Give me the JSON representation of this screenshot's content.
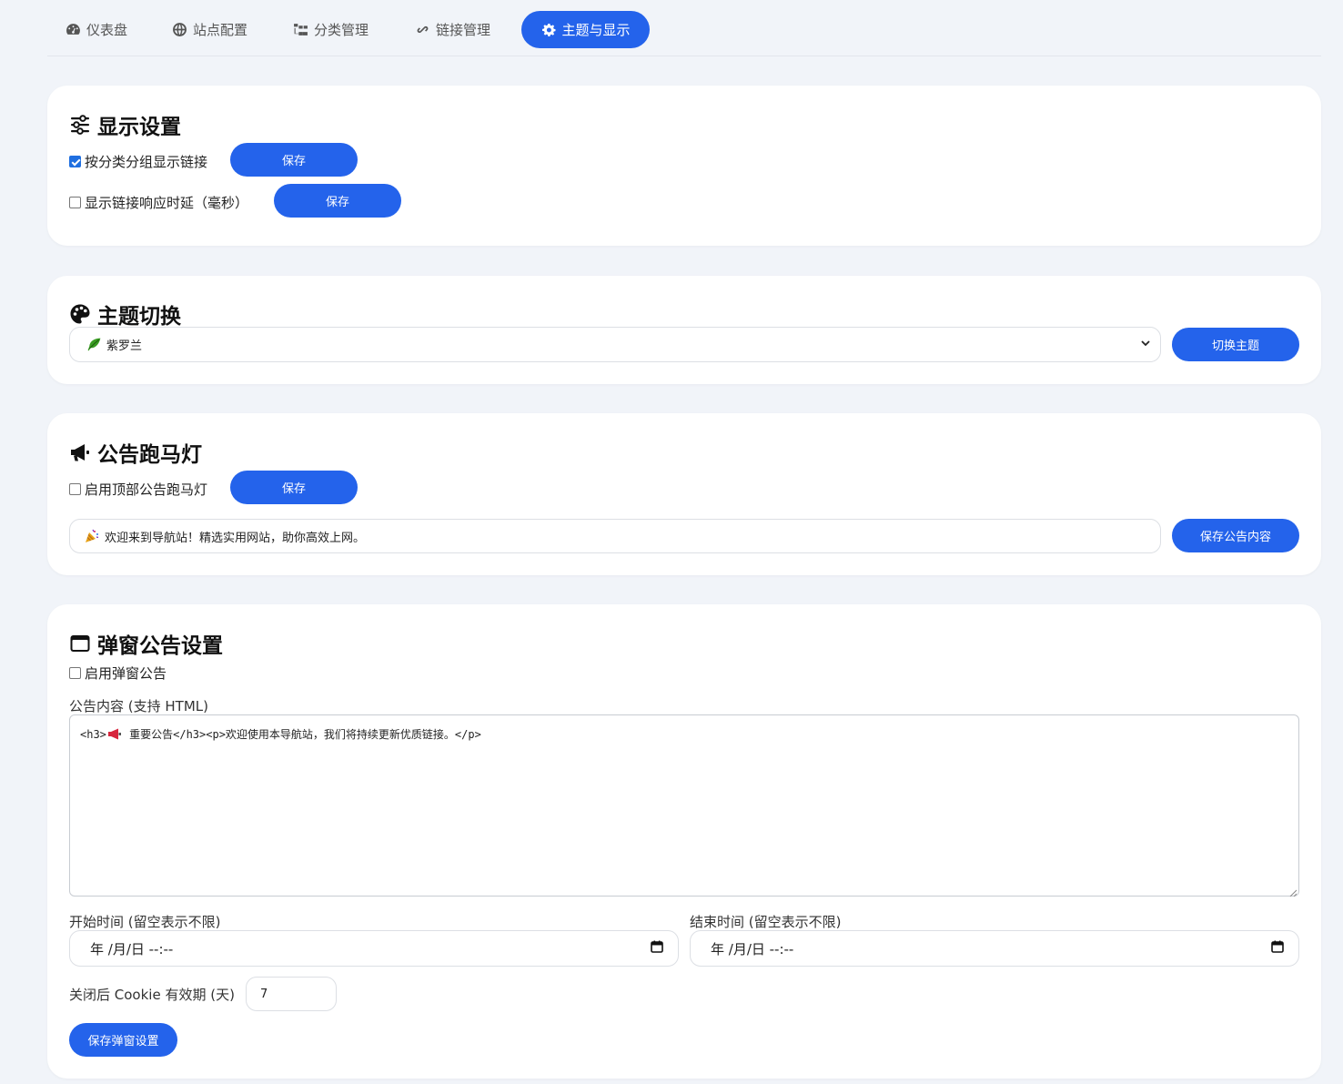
{
  "tabs": [
    {
      "label": "仪表盘",
      "icon": "dashboard-icon",
      "active": false
    },
    {
      "label": "站点配置",
      "icon": "globe-icon",
      "active": false
    },
    {
      "label": "分类管理",
      "icon": "sitemap-icon",
      "active": false
    },
    {
      "label": "链接管理",
      "icon": "link-icon",
      "active": false
    },
    {
      "label": "主题与显示",
      "icon": "gear-icon",
      "active": true
    }
  ],
  "display_settings": {
    "title": "显示设置",
    "icon": "sliders-icon",
    "group_by_category": {
      "label": "按分类分组显示链接",
      "checked": true,
      "save_label": "保存"
    },
    "show_latency": {
      "label": "显示链接响应时延（毫秒）",
      "checked": false,
      "save_label": "保存"
    }
  },
  "theme_switch": {
    "title": "主题切换",
    "icon": "palette-icon",
    "selected_option": "紫罗兰",
    "selected_option_icon": "leaf-icon",
    "button_label": "切换主题"
  },
  "marquee": {
    "title": "公告跑马灯",
    "icon": "megaphone-icon",
    "enable_label": "启用顶部公告跑马灯",
    "enabled": false,
    "save_label": "保存",
    "content_value": "欢迎来到导航站！精选实用网站，助你高效上网。",
    "content_icon": "party-popper-icon",
    "save_content_label": "保存公告内容"
  },
  "popup": {
    "title": "弹窗公告设置",
    "icon": "window-icon",
    "enable_label": "启用弹窗公告",
    "enabled": false,
    "content_label": "公告内容 (支持 HTML)",
    "content_before_icon": "<h3>",
    "content_icon": "megaphone-icon",
    "content_after_icon": " 重要公告</h3><p>欢迎使用本导航站，我们将持续更新优质链接。</p>",
    "start_label": "开始时间 (留空表示不限)",
    "end_label": "结束时间 (留空表示不限)",
    "date_placeholder": "年 /月/日 --:--",
    "cookie_label": "关闭后 Cookie 有效期 (天)",
    "cookie_days": "7",
    "save_label": "保存弹窗设置"
  },
  "colors": {
    "accent": "#2463eb",
    "background": "#f1f4f9",
    "card": "#ffffff"
  }
}
